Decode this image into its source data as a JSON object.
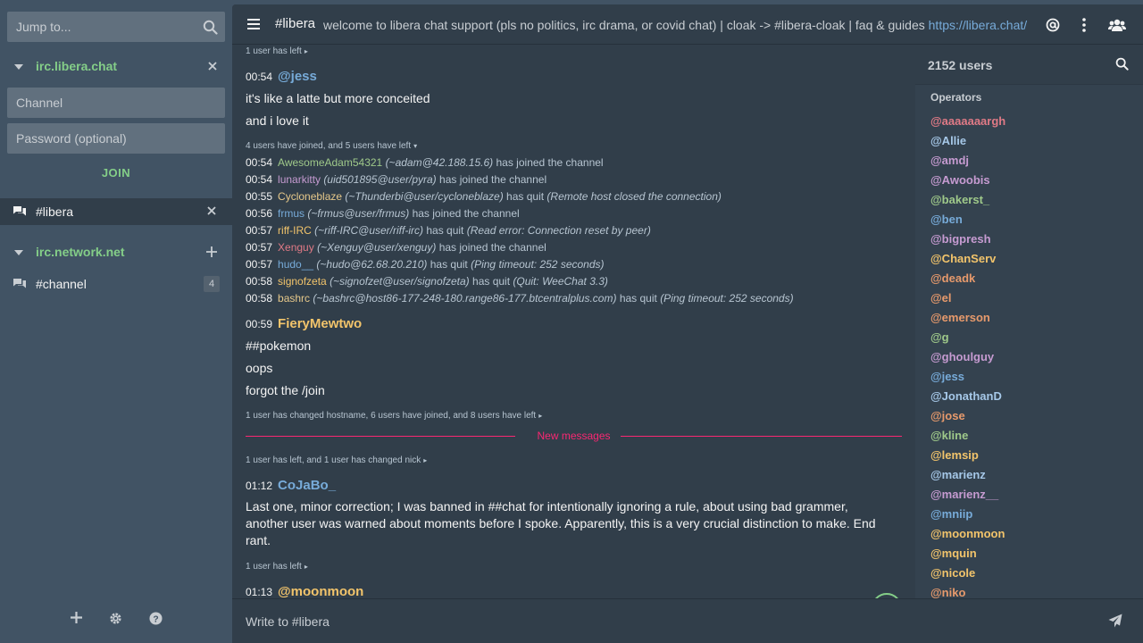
{
  "sidebar": {
    "jump_placeholder": "Jump to...",
    "networks": [
      {
        "name": "irc.libera.chat",
        "channel_placeholder": "Channel",
        "password_placeholder": "Password (optional)",
        "join_label": "JOIN"
      },
      {
        "name": "irc.network.net"
      }
    ],
    "channels": [
      {
        "name": "#libera"
      },
      {
        "name": "#channel",
        "unread": "4"
      }
    ]
  },
  "header": {
    "channel": "#libera",
    "topic": "welcome to libera chat support (pls no politics, irc drama, or covid chat) | cloak -> #libera-cloak | faq & guides ",
    "topic_link": "https://libera.chat/"
  },
  "chat": {
    "summaries": [
      "1 user has left",
      "4 users have joined, and 5 users have left",
      "1 user has changed hostname, 6 users have joined, and 8 users have left",
      "1 user has left, and 1 user has changed nick",
      "1 user has left"
    ],
    "messages": [
      {
        "time": "00:54",
        "nick": "@jess",
        "color": "#77abd9",
        "lines": [
          "it's like a latte but more conceited",
          "and i love it"
        ]
      },
      {
        "time": "00:59",
        "nick": "FieryMewtwo",
        "color": "#f2c46b",
        "lines": [
          "##pokemon",
          "oops",
          "forgot the /join"
        ]
      },
      {
        "time": "01:12",
        "nick": "CoJaBo_",
        "color": "#77abd9",
        "lines": [
          "Last one, minor correction; I was banned in ##chat for intentionally ignoring a rule, about using bad grammer, another user was warned about moments before I spoke. Apparently, this is a very crucial distinction to make. End rant."
        ]
      },
      {
        "time": "01:13",
        "nick": "@moonmoon",
        "color": "#f2c46b",
        "lines": []
      }
    ],
    "events": [
      {
        "time": "00:54",
        "nick": "AwesomeAdam54321",
        "color": "#9fc98a",
        "host": "(~adam@42.188.15.6)",
        "action": "has joined the channel",
        "reason": ""
      },
      {
        "time": "00:54",
        "nick": "lunarkitty",
        "color": "#c69bd1",
        "host": "(uid501895@user/pyra)",
        "action": "has joined the channel",
        "reason": ""
      },
      {
        "time": "00:55",
        "nick": "Cycloneblaze",
        "color": "#e6c88a",
        "host": "(~Thunderbi@user/cycloneblaze)",
        "action": "has quit",
        "reason": "(Remote host closed the connection)"
      },
      {
        "time": "00:56",
        "nick": "frmus",
        "color": "#77abd9",
        "host": "(~frmus@user/frmus)",
        "action": "has joined the channel",
        "reason": ""
      },
      {
        "time": "00:57",
        "nick": "riff-IRC",
        "color": "#f2c46b",
        "host": "(~riff-IRC@user/riff-irc)",
        "action": "has quit",
        "reason": "(Read error: Connection reset by peer)"
      },
      {
        "time": "00:57",
        "nick": "Xenguy",
        "color": "#e07a86",
        "host": "(~Xenguy@user/xenguy)",
        "action": "has joined the channel",
        "reason": ""
      },
      {
        "time": "00:57",
        "nick": "hudo__",
        "color": "#77abd9",
        "host": "(~hudo@62.68.20.210)",
        "action": "has quit",
        "reason": "(Ping timeout: 252 seconds)"
      },
      {
        "time": "00:58",
        "nick": "signofzeta",
        "color": "#f2c46b",
        "host": "(~signofzet@user/signofzeta)",
        "action": "has quit",
        "reason": "(Quit: WeeChat 3.3)"
      },
      {
        "time": "00:58",
        "nick": "bashrc",
        "color": "#e6c88a",
        "host": "(~bashrc@host86-177-248-180.range86-177.btcentralplus.com)",
        "action": "has quit",
        "reason": "(Ping timeout: 252 seconds)"
      }
    ],
    "new_messages_label": "New messages"
  },
  "userlist": {
    "count_label": "2152 users",
    "group_label": "Operators",
    "users": [
      {
        "nick": "@aaaaaaargh",
        "color": "#e07a86"
      },
      {
        "nick": "@Allie",
        "color": "#a6c8e8"
      },
      {
        "nick": "@amdj",
        "color": "#c69bd1"
      },
      {
        "nick": "@Awoobis",
        "color": "#c69bd1"
      },
      {
        "nick": "@bakerst_",
        "color": "#9fc98a"
      },
      {
        "nick": "@ben",
        "color": "#77abd9"
      },
      {
        "nick": "@bigpresh",
        "color": "#c69bd1"
      },
      {
        "nick": "@ChanServ",
        "color": "#f2c46b"
      },
      {
        "nick": "@deadk",
        "color": "#e79a6c"
      },
      {
        "nick": "@el",
        "color": "#e79a6c"
      },
      {
        "nick": "@emerson",
        "color": "#e79a6c"
      },
      {
        "nick": "@g",
        "color": "#9fc98a"
      },
      {
        "nick": "@ghoulguy",
        "color": "#c69bd1"
      },
      {
        "nick": "@jess",
        "color": "#77abd9"
      },
      {
        "nick": "@JonathanD",
        "color": "#a6c8e8"
      },
      {
        "nick": "@jose",
        "color": "#e79a6c"
      },
      {
        "nick": "@kline",
        "color": "#9fc98a"
      },
      {
        "nick": "@lemsip",
        "color": "#f2c46b"
      },
      {
        "nick": "@marienz",
        "color": "#a6c8e8"
      },
      {
        "nick": "@marienz__",
        "color": "#c69bd1"
      },
      {
        "nick": "@mniip",
        "color": "#77abd9"
      },
      {
        "nick": "@moonmoon",
        "color": "#f2c46b"
      },
      {
        "nick": "@mquin",
        "color": "#f2c46b"
      },
      {
        "nick": "@nicole",
        "color": "#f2c46b"
      },
      {
        "nick": "@niko",
        "color": "#e79a6c"
      }
    ]
  },
  "input": {
    "placeholder": "Write to #libera"
  },
  "icons": {
    "jump_search": "search-icon",
    "network_collapse": "chevron-down-icon",
    "network_close": "close-icon",
    "network_add": "plus-icon",
    "channel": "chat-bubbles-icon",
    "menu": "hamburger-icon",
    "mentions": "at-sign-icon",
    "more": "kebab-icon",
    "users": "users-icon",
    "user_search": "search-icon",
    "scroll_down": "chevron-down-icon",
    "send": "paper-plane-icon",
    "add": "plus-icon",
    "settings": "gear-icon",
    "help": "question-icon"
  },
  "colors": {
    "accent_green": "#84ce88",
    "new_messages": "#f92772",
    "link": "#77abd9"
  }
}
